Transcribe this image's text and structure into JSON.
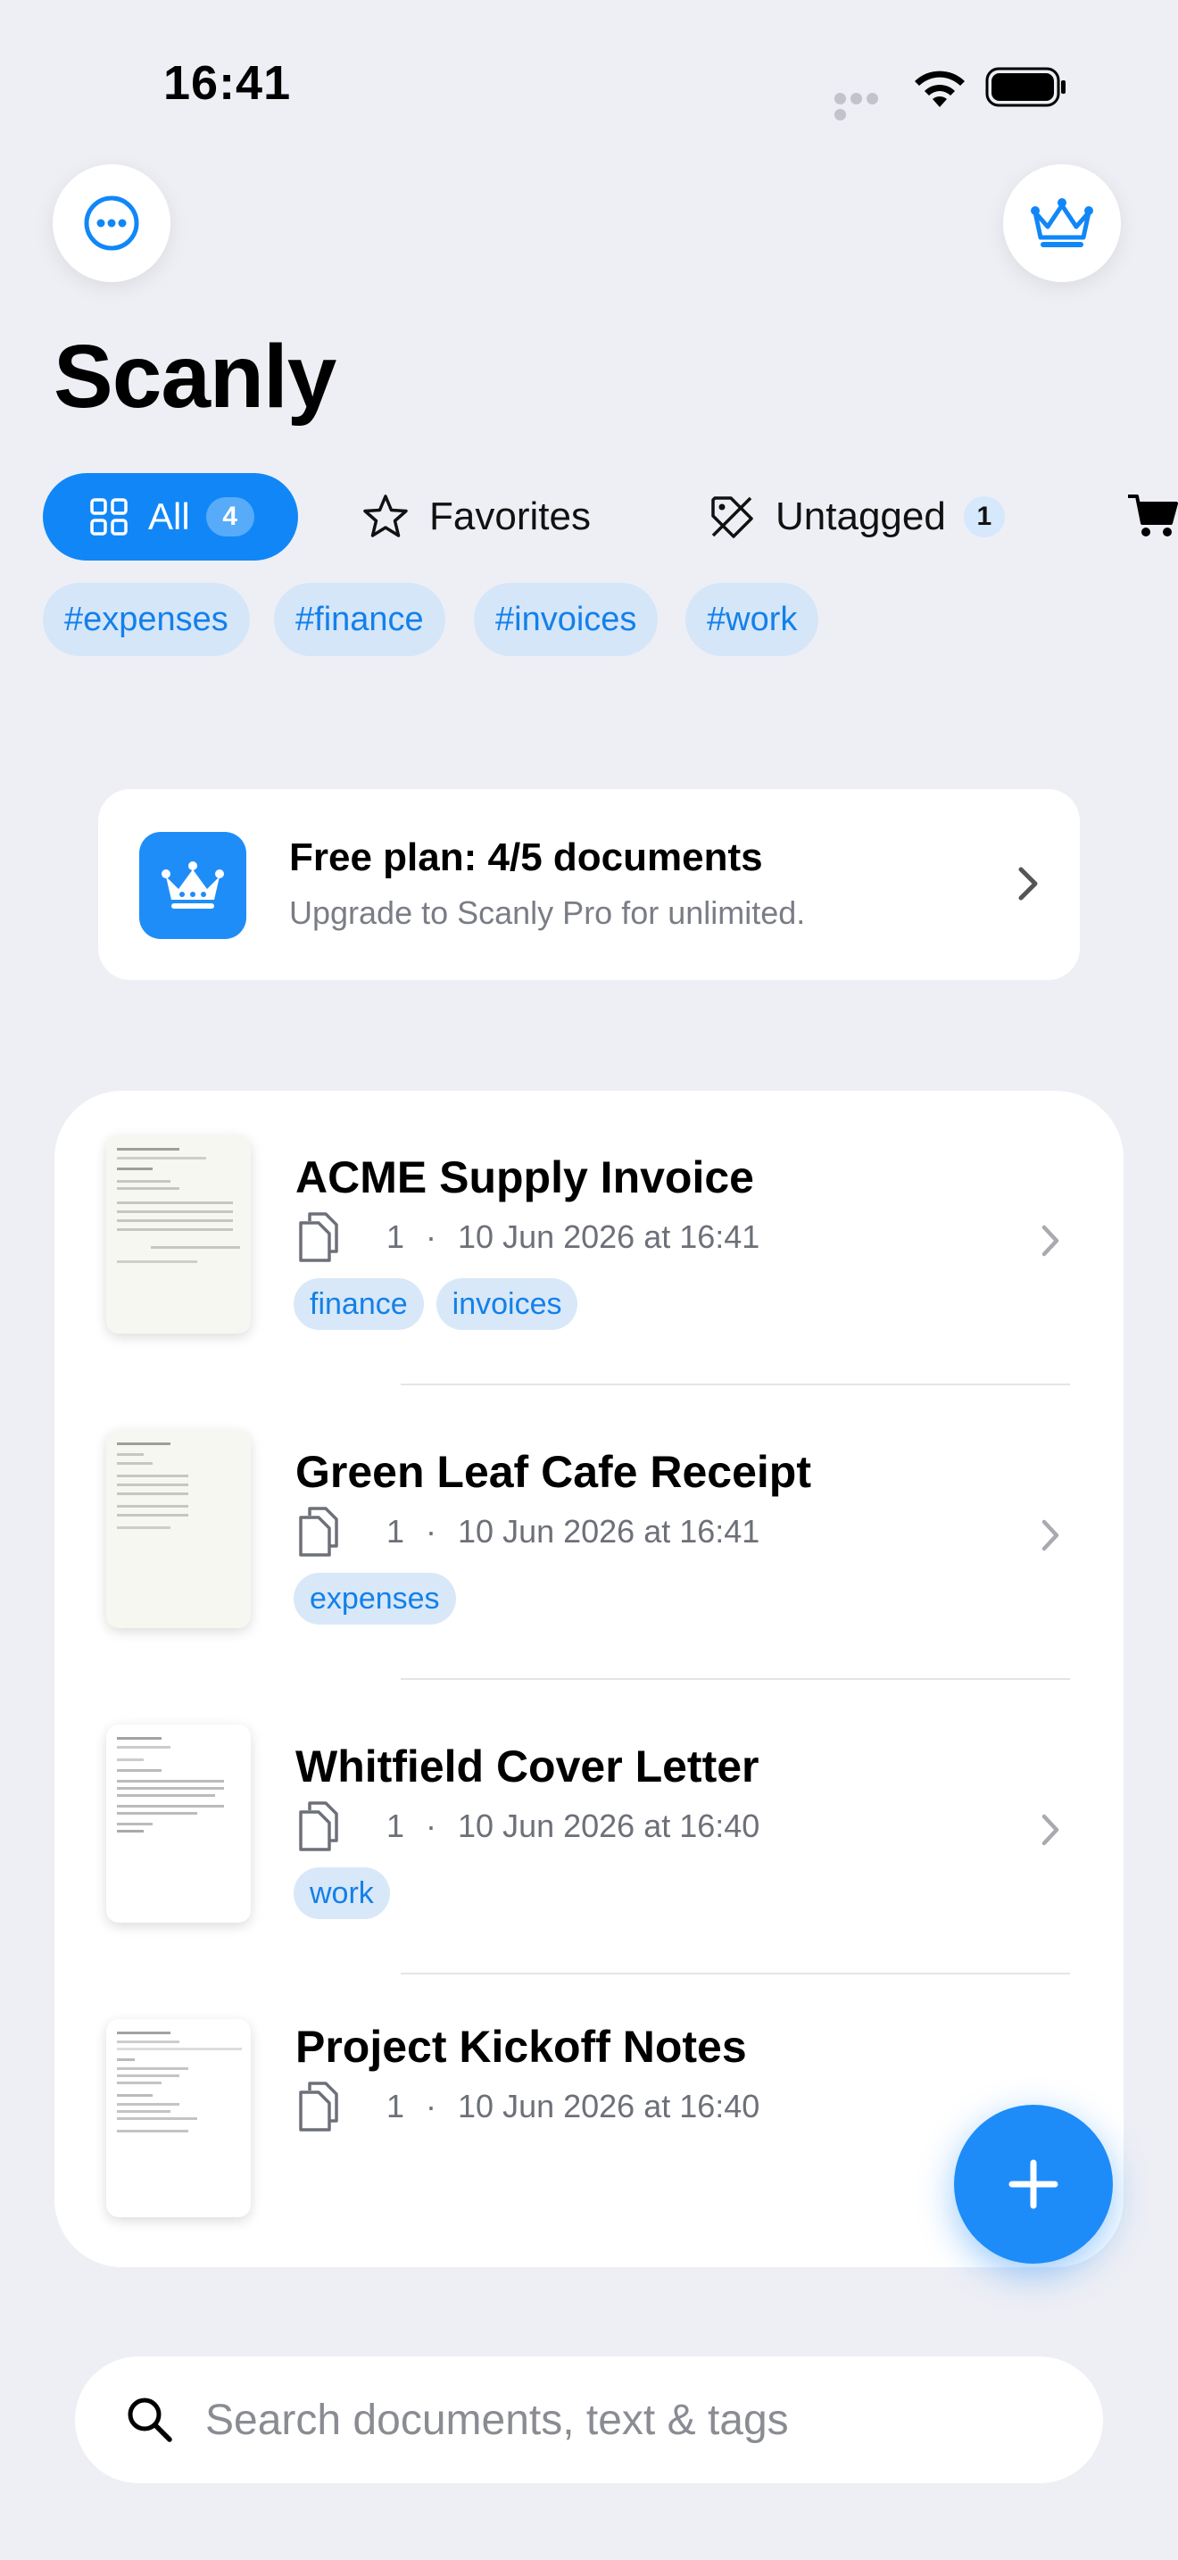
{
  "status_bar": {
    "time": "16:41"
  },
  "app": {
    "title": "Scanly"
  },
  "filters": {
    "all": {
      "label": "All",
      "count": "4"
    },
    "favorites": {
      "label": "Favorites"
    },
    "untagged": {
      "label": "Untagged",
      "count": "1"
    }
  },
  "tags": [
    "#expenses",
    "#finance",
    "#invoices",
    "#work"
  ],
  "upgrade": {
    "title": "Free plan: 4/5 documents",
    "subtitle": "Upgrade to Scanly Pro for unlimited."
  },
  "documents": [
    {
      "title": "ACME Supply Invoice",
      "pages": "1",
      "date": "10 Jun 2026 at 16:41",
      "tags": [
        "finance",
        "invoices"
      ]
    },
    {
      "title": "Green Leaf Cafe Receipt",
      "pages": "1",
      "date": "10 Jun 2026 at 16:41",
      "tags": [
        "expenses"
      ]
    },
    {
      "title": "Whitfield Cover Letter",
      "pages": "1",
      "date": "10 Jun 2026 at 16:40",
      "tags": [
        "work"
      ]
    },
    {
      "title": "Project Kickoff Notes",
      "pages": "1",
      "date": "10 Jun 2026 at 16:40",
      "tags": []
    }
  ],
  "meta_separator": "·",
  "search": {
    "placeholder": "Search documents, text & tags"
  },
  "colors": {
    "accent": "#1187f7",
    "background": "#eeeff5",
    "chip_bg": "#d5e6f9"
  }
}
